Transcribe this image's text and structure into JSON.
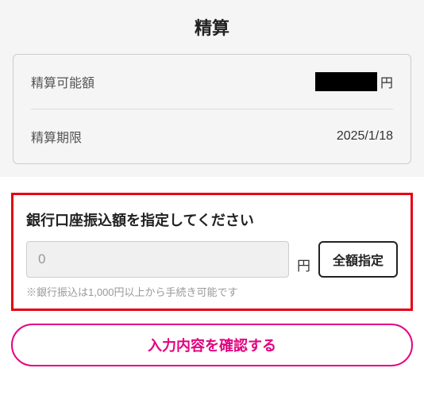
{
  "page": {
    "title": "精算"
  },
  "info": {
    "available_label": "精算可能額",
    "available_currency": "円",
    "deadline_label": "精算期限",
    "deadline_value": "2025/1/18"
  },
  "input_section": {
    "heading": "銀行口座振込額を指定してください",
    "placeholder": "0",
    "currency": "円",
    "full_amount_label": "全額指定",
    "note": "※銀行振込は1,000円以上から手続き可能です"
  },
  "actions": {
    "confirm_label": "入力内容を確認する"
  }
}
